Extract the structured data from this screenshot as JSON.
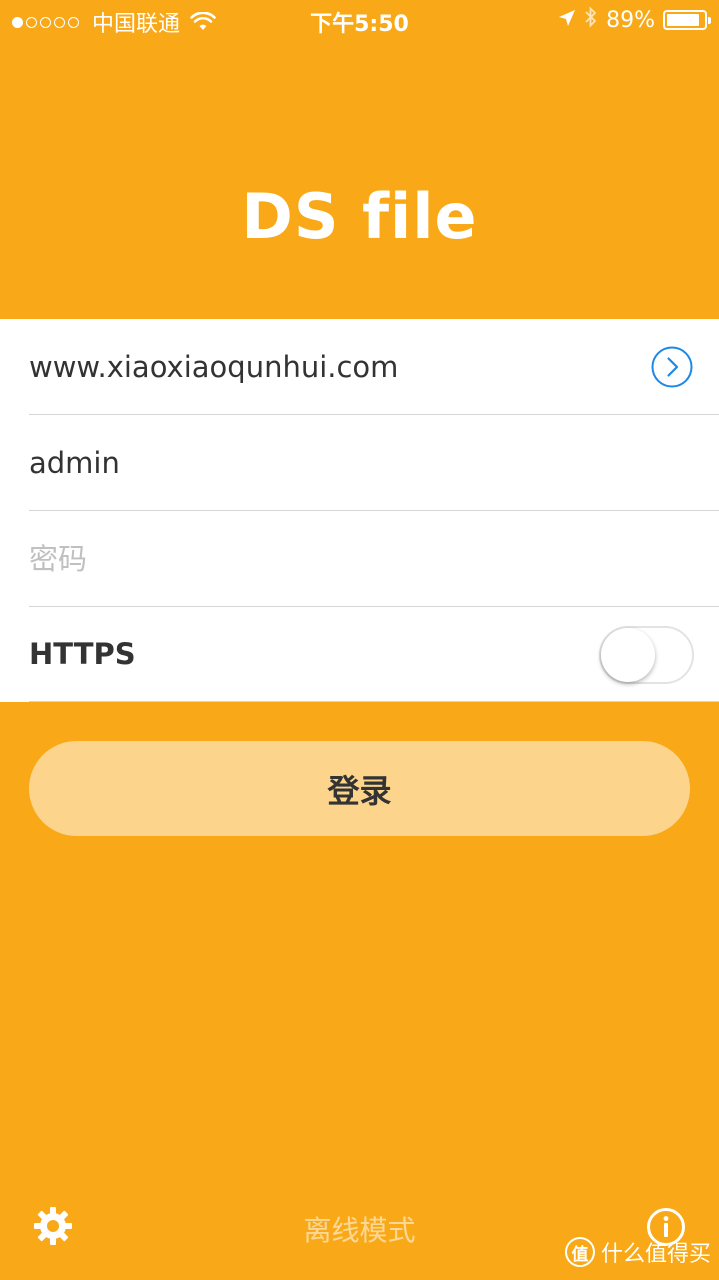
{
  "status_bar": {
    "carrier": "中国联通",
    "time": "下午5:50",
    "battery": "89%",
    "battery_level": 0.89,
    "signal_bars_filled": 1,
    "signal_bars_total": 5,
    "icons": [
      "wifi-icon",
      "location-arrow-icon",
      "bluetooth-icon",
      "battery-icon"
    ]
  },
  "app": {
    "title": "DS file"
  },
  "form": {
    "server_value": "www.xiaoxiaoqunhui.com",
    "username_value": "admin",
    "password_placeholder": "密码",
    "https_label": "HTTPS",
    "https_enabled": false
  },
  "login": {
    "label": "登录"
  },
  "bottom_bar": {
    "offline_label": "离线模式",
    "settings_icon": "gear-icon",
    "info_icon": "info-icon"
  },
  "watermark": {
    "text": "什么值得买",
    "badge": "值"
  },
  "colors": {
    "background": "#F9A918",
    "login_button": "#FCD48C",
    "accent_blue": "#1E88E5",
    "white": "#FFFFFF"
  }
}
